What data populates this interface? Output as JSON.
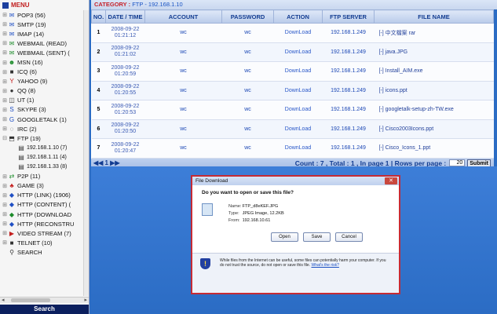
{
  "menu": {
    "title": "MENU",
    "items": [
      {
        "label": "POP3 (56)",
        "icon": "mail-icon"
      },
      {
        "label": "SMTP (19)",
        "icon": "mail-send-icon"
      },
      {
        "label": "IMAP (14)",
        "icon": "mail-icon"
      },
      {
        "label": "WEBMAIL (READ)",
        "icon": "webmail-icon"
      },
      {
        "label": "WEBMAIL (SENT) (",
        "icon": "webmail-icon"
      },
      {
        "label": "MSN (16)",
        "icon": "msn-icon"
      },
      {
        "label": "ICQ (6)",
        "icon": "icq-icon"
      },
      {
        "label": "YAHOO (9)",
        "icon": "yahoo-icon"
      },
      {
        "label": "QQ (8)",
        "icon": "qq-icon"
      },
      {
        "label": "UT (1)",
        "icon": "ut-icon"
      },
      {
        "label": "SKYPE (3)",
        "icon": "skype-icon"
      },
      {
        "label": "GOOGLETALK (1)",
        "icon": "googletalk-icon"
      },
      {
        "label": "IRC (2)",
        "icon": "irc-icon"
      },
      {
        "label": "FTP (19)",
        "icon": "ftp-icon"
      }
    ],
    "ftp_children": [
      "192.168.1.10 (7)",
      "192.168.1.11 (4)",
      "192.168.1.33 (8)"
    ],
    "items_after": [
      {
        "label": "P2P (11)",
        "icon": "p2p-icon"
      },
      {
        "label": "GAME (3)",
        "icon": "game-icon"
      },
      {
        "label": "HTTP (LINK) (1906)",
        "icon": "http-icon"
      },
      {
        "label": "HTTP (CONTENT) (",
        "icon": "http-icon"
      },
      {
        "label": "HTTP (DOWNLOAD",
        "icon": "http-download-icon"
      },
      {
        "label": "HTTP (RECONSTRU",
        "icon": "http-icon"
      },
      {
        "label": "VIDEO STREAM (7)",
        "icon": "video-icon"
      },
      {
        "label": "TELNET (10)",
        "icon": "telnet-icon"
      },
      {
        "label": "SEARCH",
        "icon": "search-icon"
      }
    ],
    "search_bar": "Search"
  },
  "category": {
    "label": "CATEGORY :",
    "value": "FTP - 192.168.1.10"
  },
  "table": {
    "headers": [
      "NO.",
      "DATE / TIME",
      "ACCOUNT",
      "PASSWORD",
      "ACTION",
      "FTP SERVER",
      "FILE NAME"
    ],
    "rows": [
      {
        "no": "1",
        "date": "2008-09-22",
        "time": "01:21:12",
        "account": "wc",
        "password": "wc",
        "action": "DownLoad",
        "server": "192.168.1.249",
        "file": "[-] 中文檔案 rar"
      },
      {
        "no": "2",
        "date": "2008-09-22",
        "time": "01:21:02",
        "account": "wc",
        "password": "wc",
        "action": "DownLoad",
        "server": "192.168.1.249",
        "file": "[-] java.JPG"
      },
      {
        "no": "3",
        "date": "2008-09-22",
        "time": "01:20:59",
        "account": "wc",
        "password": "wc",
        "action": "DownLoad",
        "server": "192.168.1.249",
        "file": "[-] Install_AIM.exe"
      },
      {
        "no": "4",
        "date": "2008-09-22",
        "time": "01:20:55",
        "account": "wc",
        "password": "wc",
        "action": "DownLoad",
        "server": "192.168.1.249",
        "file": "[-] icons.ppt"
      },
      {
        "no": "5",
        "date": "2008-09-22",
        "time": "01:20:53",
        "account": "wc",
        "password": "wc",
        "action": "DownLoad",
        "server": "192.168.1.249",
        "file": "[-] googletalk-setup-zh-TW.exe"
      },
      {
        "no": "6",
        "date": "2008-09-22",
        "time": "01:20:50",
        "account": "wc",
        "password": "wc",
        "action": "DownLoad",
        "server": "192.168.1.249",
        "file": "[-] Cisco2003Icons.ppt"
      },
      {
        "no": "7",
        "date": "2008-09-22",
        "time": "01:20:47",
        "account": "wc",
        "password": "wc",
        "action": "DownLoad",
        "server": "192.168.1.249",
        "file": "[-] Cisco_Icons_1.ppt"
      }
    ]
  },
  "pager": {
    "nav": "◀◀ 1 ▶▶",
    "stats": "Count : 7 , Total : 1 , In page 1 | Rows per page :",
    "rows_per_page": "20",
    "submit": "Submit"
  },
  "dialog": {
    "title": "File Download",
    "question": "Do you want to open or save this file?",
    "name_label": "Name:",
    "name_value": "FTP_d8eKEF.JPG",
    "type_label": "Type:",
    "type_value": "JPEG Image, 12.2KB",
    "from_label": "From:",
    "from_value": "192.168.10.61",
    "open_label": "Open",
    "save_label": "Save",
    "cancel_label": "Cancel",
    "warning": "While files from the Internet can be useful, some files can potentially harm your computer. If you do not trust the source, do not open or save this file.",
    "warning_link": "What's the risk?"
  }
}
